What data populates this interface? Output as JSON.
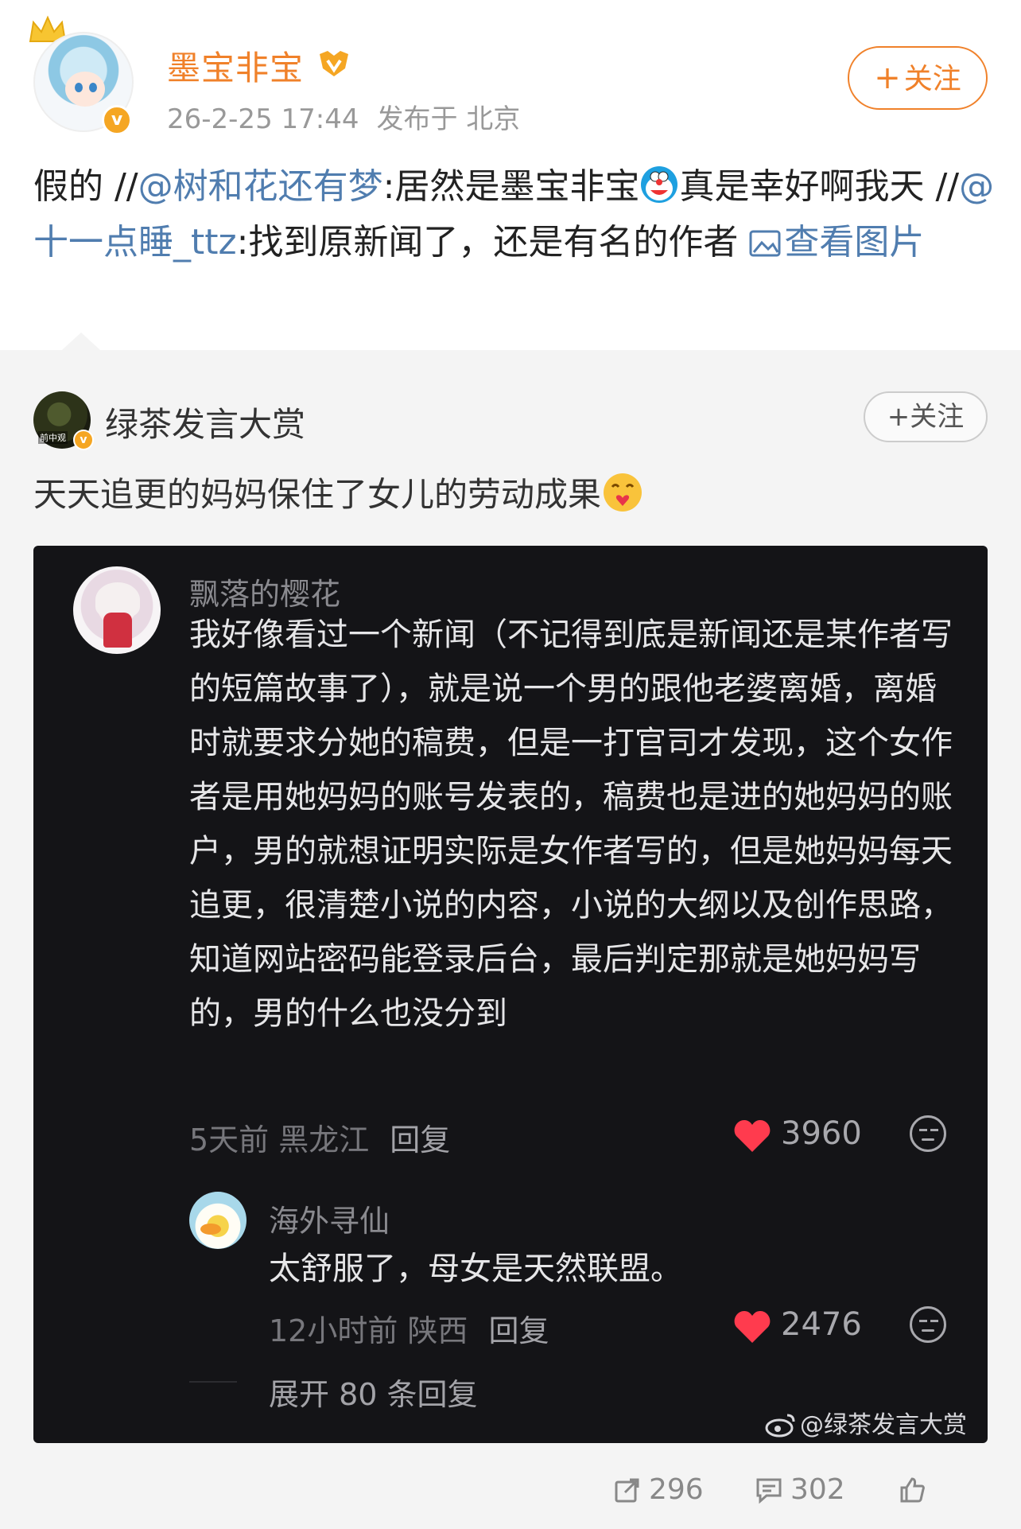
{
  "post": {
    "username": "墨宝非宝",
    "timestamp": "26-2-25 17:44",
    "location": "发布于 北京",
    "follow_label": "关注",
    "text": {
      "p1": "假的 //",
      "m1": "@树和花还有梦",
      "p2": ":居然是墨宝非宝",
      "p3": "真是幸好啊我天 //",
      "m2": "@十一点睡_ttz",
      "p4": ":找到原新闻了，还是有名的作者 ",
      "link": "查看图片"
    }
  },
  "repost": {
    "username": "绿茶发言大赏",
    "avatar_tag": "前中观",
    "follow_label": "关注",
    "text": "天天追更的妈妈保住了女儿的劳动成果",
    "screenshot": {
      "comment1": {
        "name": "飘落的樱花",
        "body": "我好像看过一个新闻（不记得到底是新闻还是某作者写的短篇故事了），就是说一个男的跟他老婆离婚，离婚时就要求分她的稿费，但是一打官司才发现，这个女作者是用她妈妈的账号发表的，稿费也是进的她妈妈的账户，男的就想证明实际是女作者写的，但是她妈妈每天追更，很清楚小说的内容，小说的大纲以及创作思路，知道网站密码能登录后台，最后判定那就是她妈妈写的，男的什么也没分到",
        "time": "5天前",
        "location": "黑龙江",
        "reply": "回复",
        "likes": "3960"
      },
      "comment2": {
        "name": "海外寻仙",
        "body": "太舒服了，母女是天然联盟。",
        "time": "12小时前",
        "location": "陕西",
        "reply": "回复",
        "likes": "2476"
      },
      "expand": "展开 80 条回复",
      "watermark": "@绿茶发言大赏"
    }
  },
  "actions": {
    "reposts": "296",
    "comments": "302",
    "likes": ""
  },
  "colors": {
    "accent": "#f0812a",
    "mention": "#507daf",
    "heart": "#ff3b4e",
    "card_bg": "#141417"
  },
  "icons": [
    "crown-icon",
    "vip-badge-icon",
    "verified-icon",
    "doraemon-emoji-icon",
    "heart-face-emoji-icon",
    "image-icon",
    "heart-icon",
    "smiley-icon",
    "weibo-logo-icon",
    "repost-icon",
    "comment-icon",
    "like-icon"
  ]
}
